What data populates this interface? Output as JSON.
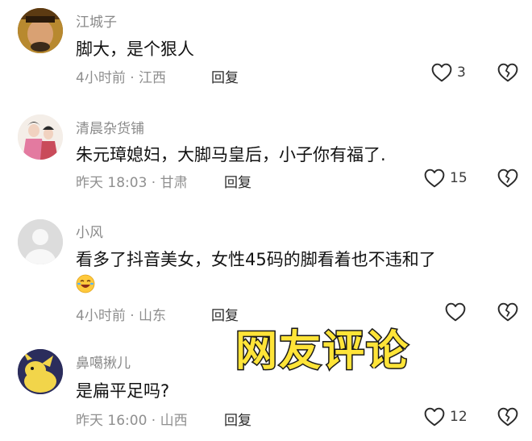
{
  "comments": [
    {
      "name": "江城子",
      "text": "脚大，是个狠人",
      "meta": "4小时前 · 江西",
      "reply": "回复",
      "likes": "3"
    },
    {
      "name": "清晨杂货铺",
      "text": "朱元璋媳妇，大脚马皇后，小子你有福了.",
      "meta": "昨天 18:03 · 甘肃",
      "reply": "回复",
      "likes": "15"
    },
    {
      "name": "小风",
      "text": "看多了抖音美女，女性45码的脚看着也不违和了",
      "meta": "4小时前 · 山东",
      "reply": "回复",
      "likes": ""
    },
    {
      "name": "鼻噶揪儿",
      "text": "是扁平足吗?",
      "meta": "昨天 16:00 · 山西",
      "reply": "回复",
      "likes": "12"
    }
  ],
  "overlay_text": "网友评论",
  "icons": [
    "heart-outline-icon",
    "broken-heart-icon",
    "laughing-emoji-icon"
  ],
  "colors": {
    "meta": "#8f8f8f",
    "overlay": "#FFE438"
  }
}
